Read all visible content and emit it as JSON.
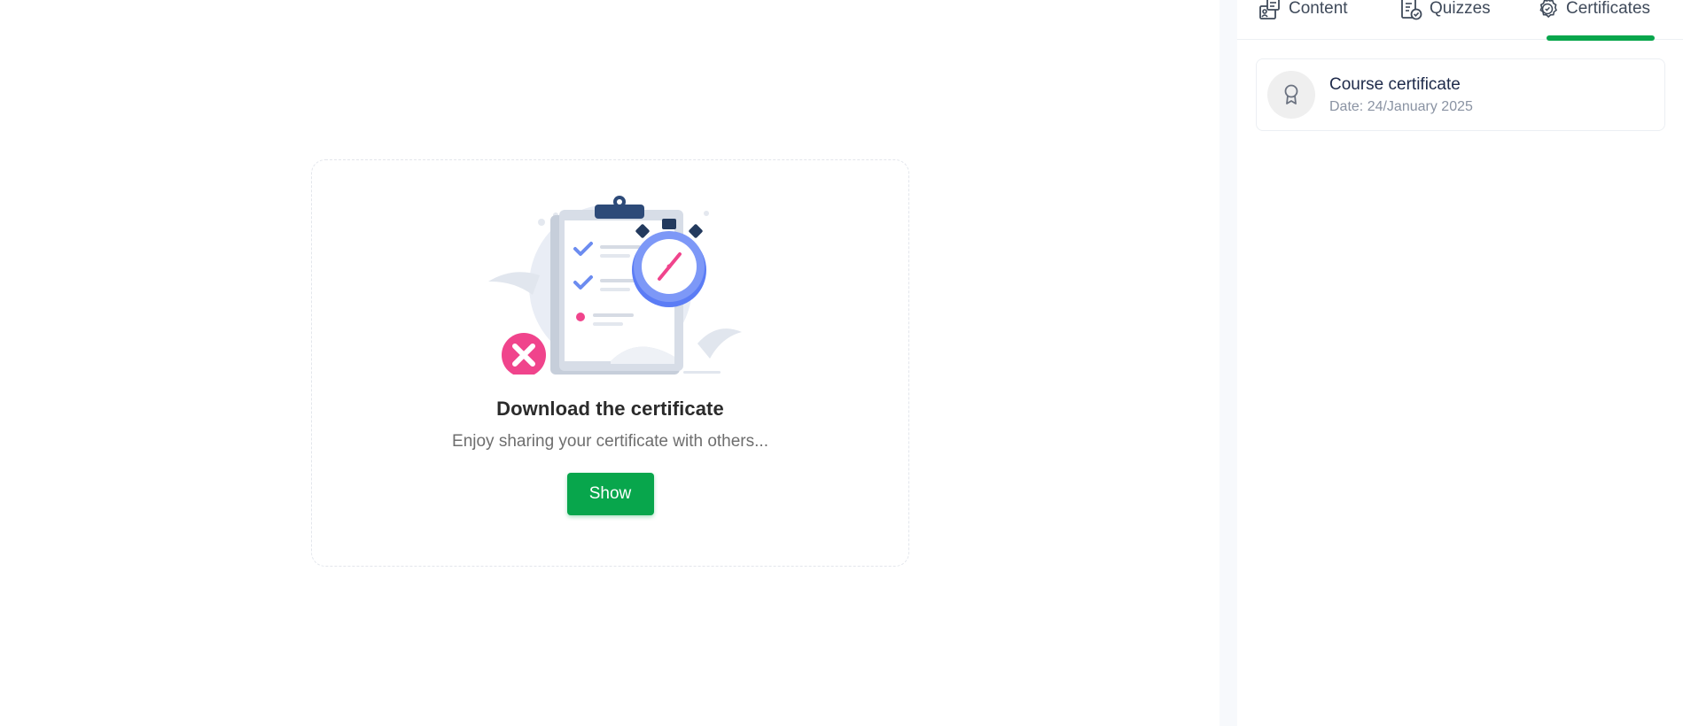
{
  "empty_state": {
    "title": "Download the certificate",
    "subtitle": "Enjoy sharing your certificate with others...",
    "button_label": "Show"
  },
  "sidebar": {
    "tabs": [
      {
        "label": "Content",
        "icon": "content-icon"
      },
      {
        "label": "Quizzes",
        "icon": "quiz-icon"
      },
      {
        "label": "Certificates",
        "icon": "certificate-icon",
        "active": true
      }
    ],
    "certificates": [
      {
        "title": "Course certificate",
        "date": "Date: 24/January 2025",
        "icon": "award-icon"
      }
    ]
  },
  "colors": {
    "accent": "#08a64c",
    "clipboard_blue": "#6c8cf0",
    "danger_pink": "#f0448c",
    "dark_navy": "#2d4a78"
  }
}
